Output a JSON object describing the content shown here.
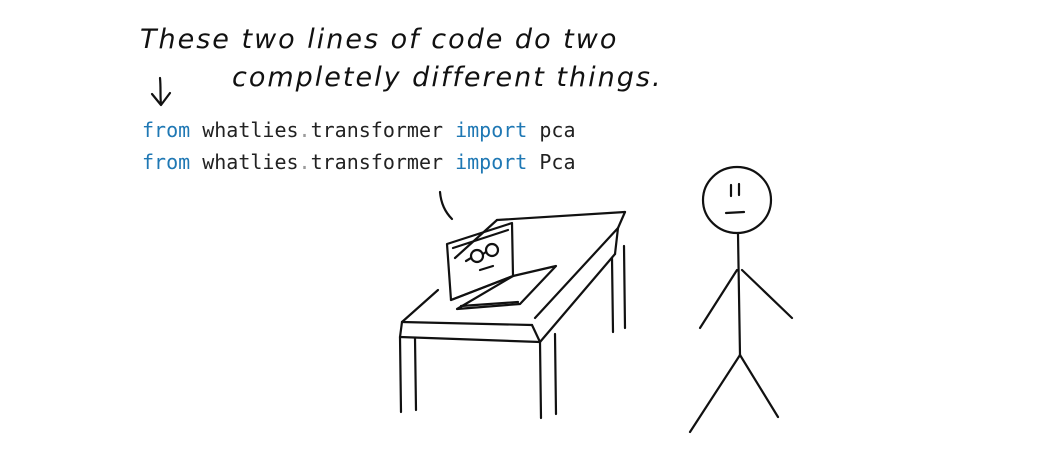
{
  "note": {
    "line1": "These two lines of code do two",
    "line2": "completely different things."
  },
  "code_lines": [
    {
      "kw_from": "from",
      "module_a": "whatlies",
      "sep": ".",
      "module_b": "transformer",
      "kw_import": "import",
      "name": "pca"
    },
    {
      "kw_from": "from",
      "module_a": "whatlies",
      "sep": ".",
      "module_b": "transformer",
      "kw_import": "import",
      "name": "Pca"
    }
  ],
  "colors": {
    "keyword": "#1f78b4",
    "ink": "#111111"
  }
}
